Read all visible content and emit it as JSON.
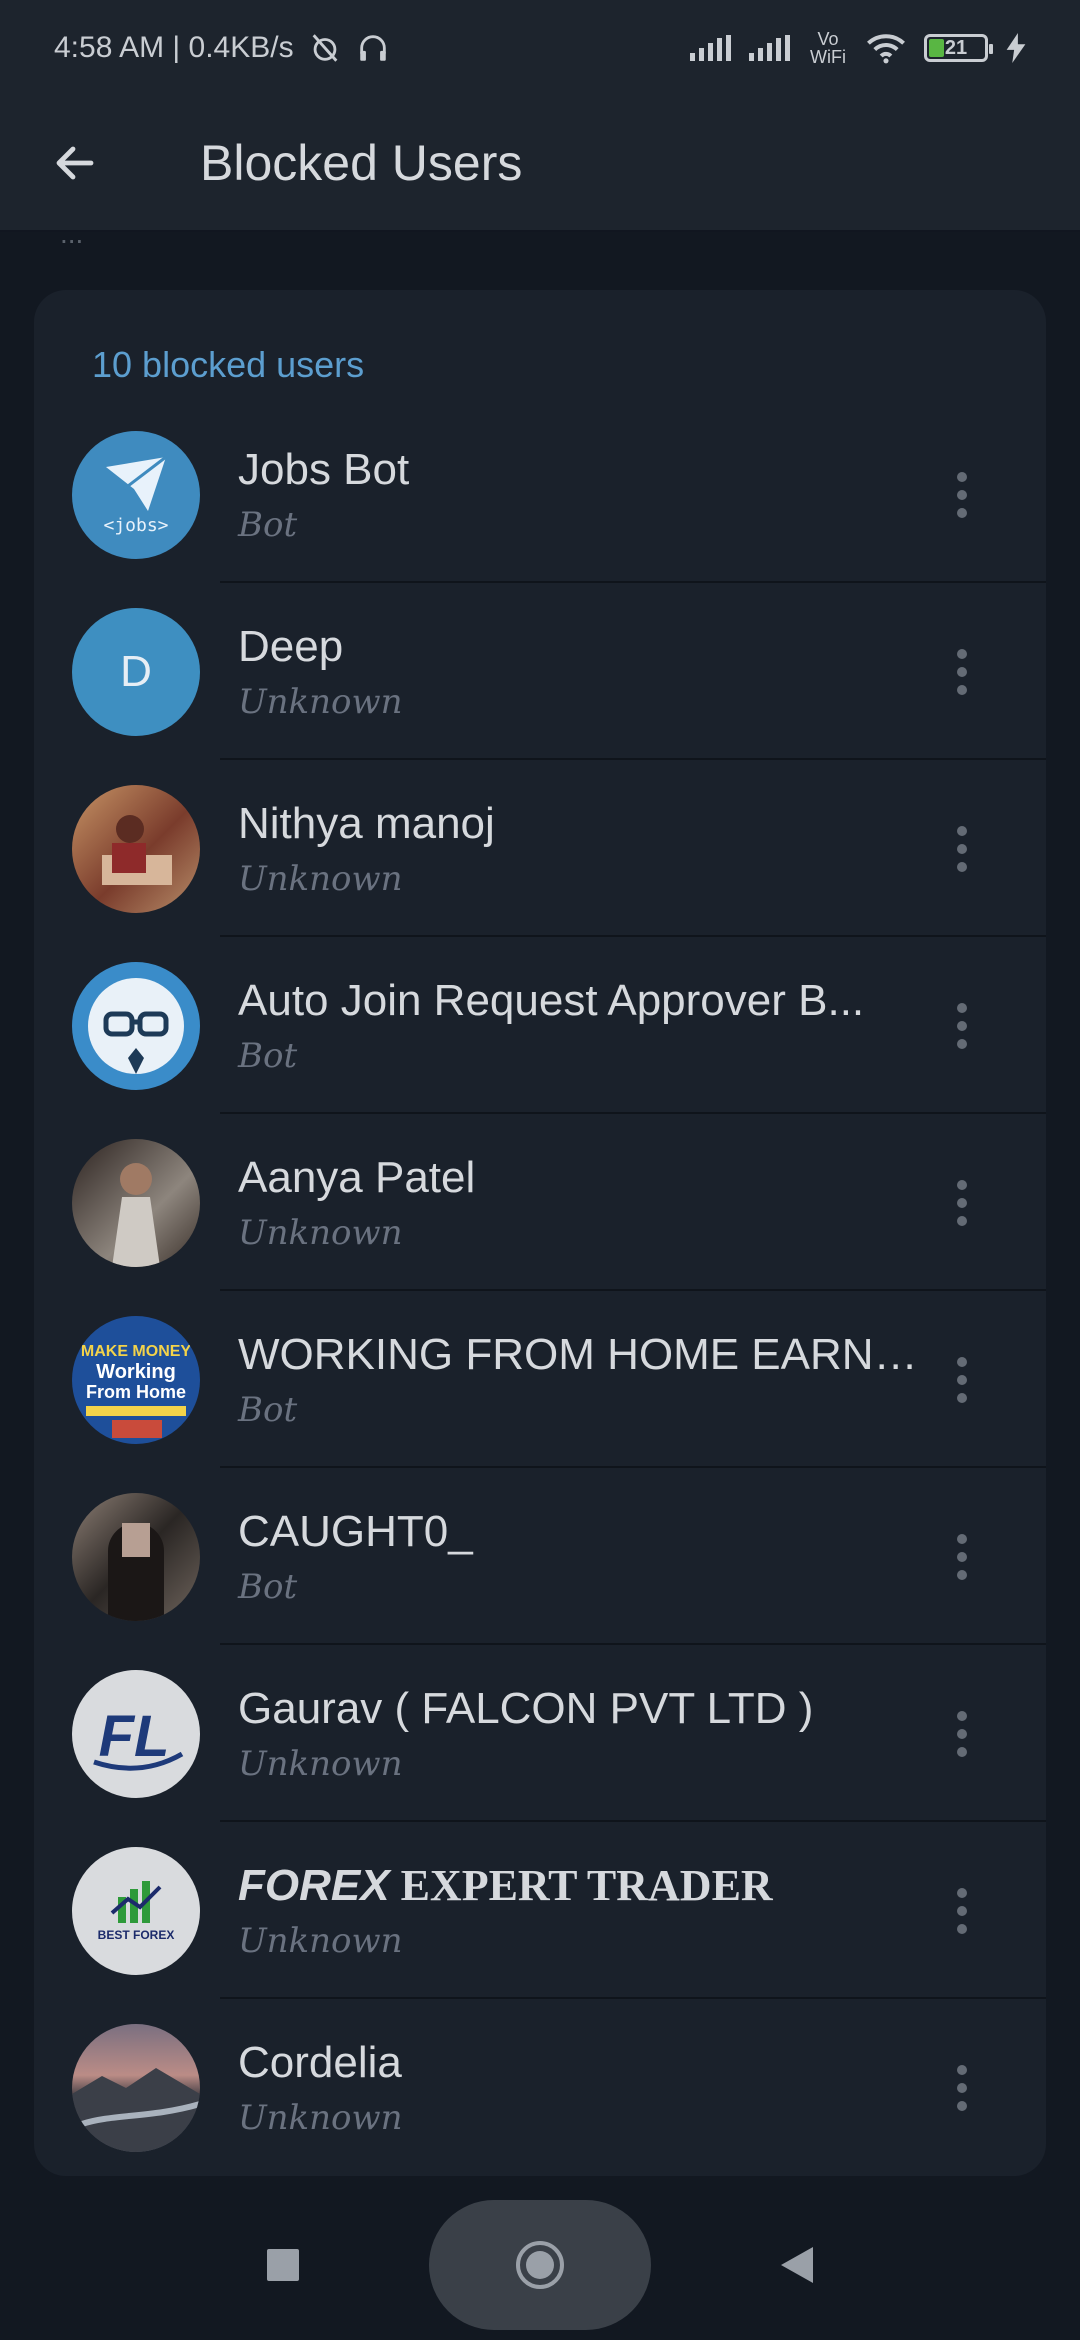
{
  "status_bar": {
    "time_speed": "4:58 AM | 0.4KB/s",
    "network_label": "Vo WiFi",
    "battery_level": "21"
  },
  "app_bar": {
    "title": "Blocked Users"
  },
  "peek_text": "...",
  "list": {
    "header": "10 blocked users",
    "users": [
      {
        "name": "Jobs Bot",
        "status": "Bot",
        "avatar": "jobs-bot-avatar",
        "avatar_text": "<jobs>",
        "color": "#3f8bbf"
      },
      {
        "name": "Deep",
        "status": "Unknown",
        "avatar": "letter-avatar",
        "avatar_text": "D",
        "color": "#3e8fc1"
      },
      {
        "name": "Nithya manoj",
        "status": "Unknown",
        "avatar": "photo-avatar",
        "avatar_text": "",
        "color": "#9a6b4c"
      },
      {
        "name": "Auto Join Request Approver B...",
        "status": "Bot",
        "avatar": "robot-avatar",
        "avatar_text": "",
        "color": "#3a8cc9"
      },
      {
        "name": "Aanya Patel",
        "status": "Unknown",
        "avatar": "photo-avatar",
        "avatar_text": "",
        "color": "#7e7a76"
      },
      {
        "name": "WORKING FROM HOME EARNI...",
        "status": "Bot",
        "avatar": "book-cover-avatar",
        "avatar_text": "Working From Home",
        "color": "#1e4f9a"
      },
      {
        "name": "CAUGHT0_",
        "status": "Bot",
        "avatar": "photo-avatar",
        "avatar_text": "",
        "color": "#6f655e"
      },
      {
        "name": "Gaurav ( FALCON PVT LTD )",
        "status": "Unknown",
        "avatar": "fl-logo-avatar",
        "avatar_text": "FL",
        "color": "#d9dbde"
      },
      {
        "name_prefix": "FOREX",
        "name": "EXPERT TRADER",
        "status": "Unknown",
        "avatar": "forex-logo-avatar",
        "avatar_text": "BEST FOREX",
        "color": "#d9dbde"
      },
      {
        "name": "Cordelia",
        "status": "Unknown",
        "avatar": "landscape-avatar",
        "avatar_text": "",
        "color": "#5a5560"
      }
    ]
  }
}
